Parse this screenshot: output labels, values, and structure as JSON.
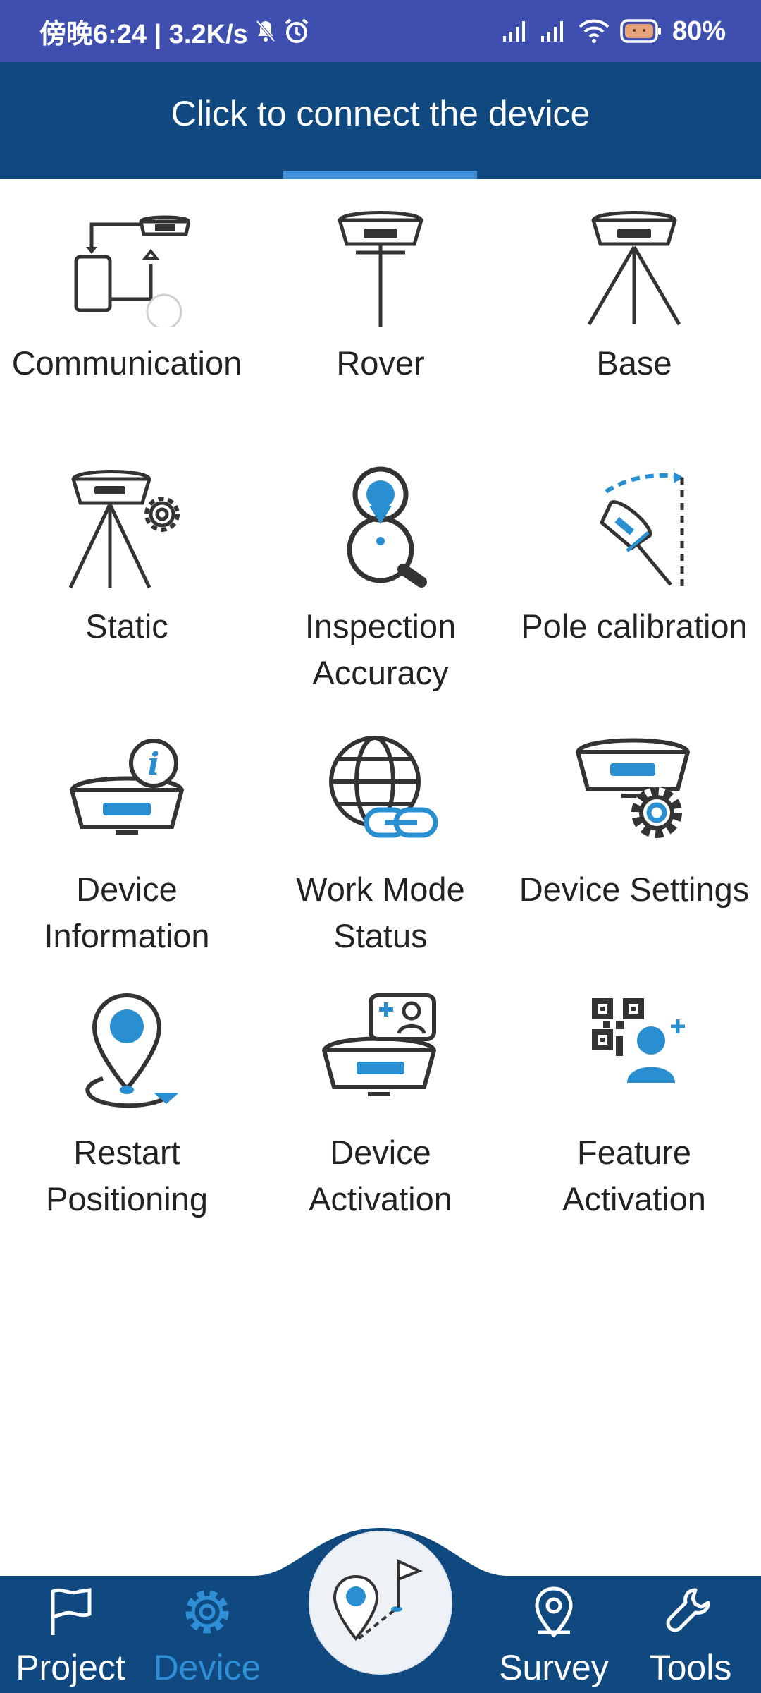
{
  "status_bar": {
    "time_speed": "傍晚6:24 | 3.2K/s",
    "battery_percent": "80%",
    "icons": [
      "mute-icon",
      "alarm-icon",
      "signal-icon",
      "signal-icon",
      "wifi-icon",
      "battery-icon"
    ]
  },
  "header": {
    "title": "Click to connect the device"
  },
  "tiles": [
    {
      "label": "Communication",
      "icon": "communication-icon"
    },
    {
      "label": "Rover",
      "icon": "rover-icon"
    },
    {
      "label": "Base",
      "icon": "base-icon"
    },
    {
      "label": "Static",
      "icon": "static-icon"
    },
    {
      "label": "Inspection\nAccuracy",
      "icon": "inspection-icon"
    },
    {
      "label": "Pole calibration",
      "icon": "pole-calibration-icon"
    },
    {
      "label": "Device\nInformation",
      "icon": "device-info-icon"
    },
    {
      "label": "Work Mode\nStatus",
      "icon": "work-mode-icon"
    },
    {
      "label": "Device Settings",
      "icon": "device-settings-icon"
    },
    {
      "label": "Restart\nPositioning",
      "icon": "restart-positioning-icon"
    },
    {
      "label": "Device\nActivation",
      "icon": "device-activation-icon"
    },
    {
      "label": "Feature\nActivation",
      "icon": "feature-activation-icon"
    }
  ],
  "bottom_nav": {
    "items": [
      {
        "label": "Project",
        "icon": "flag-icon"
      },
      {
        "label": "Device",
        "icon": "gear-icon",
        "active": true
      },
      {
        "label": "Survey",
        "icon": "location-pin-icon"
      },
      {
        "label": "Tools",
        "icon": "wrench-icon"
      }
    ],
    "center_icon": "stakeout-icon"
  },
  "colors": {
    "status_bar": "#3f4fb0",
    "header": "#10497f",
    "accent": "#2f8fd6",
    "icon_dark": "#333333"
  }
}
